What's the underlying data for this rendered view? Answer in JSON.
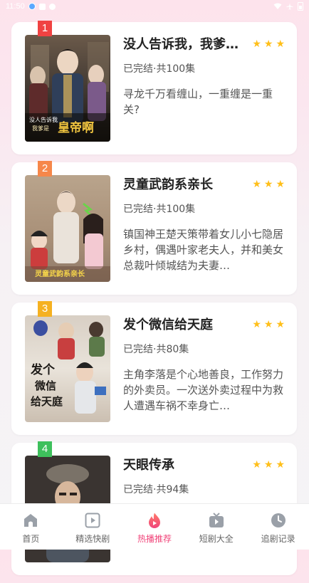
{
  "status_bar": {
    "time": "11:50"
  },
  "colors": {
    "accent": "#f0457a",
    "star": "#ffbf1a",
    "rank_1": "#f04242",
    "rank_2": "#f6874a",
    "rank_3": "#f5b121",
    "rank_4": "#3ec05c"
  },
  "dramas": [
    {
      "rank": "1",
      "title": "没人告诉我，我爹是皇帝啊",
      "status": "已完结·共100集",
      "description": "寻龙千万看缠山，一重缠是一重关?",
      "poster_text": "没人告诉我 我爹是皇帝啊",
      "stars": 3
    },
    {
      "rank": "2",
      "title": "灵童武韵系亲长",
      "status": "已完结·共100集",
      "description": "镇国神王楚天策带着女儿小七隐居乡村，偶遇叶家老夫人，并和美女总裁叶倾城结为夫妻…",
      "poster_text": "灵童武韵系亲长",
      "stars": 3
    },
    {
      "rank": "3",
      "title": "发个微信给天庭",
      "status": "已完结·共80集",
      "description": "主角李落是个心地善良，工作努力的外卖员。一次送外卖过程中为救人遭遇车祸不幸身亡…",
      "poster_text": "发个微信给天庭",
      "stars": 3
    },
    {
      "rank": "4",
      "title": "天眼传承",
      "status": "已完结·共94集",
      "description": "",
      "stars": 3
    }
  ],
  "tabbar": {
    "tabs": [
      {
        "label": "首页",
        "icon": "home-icon"
      },
      {
        "label": "精选快剧",
        "icon": "play-square-icon"
      },
      {
        "label": "热播推荐",
        "icon": "flame-icon",
        "active": true
      },
      {
        "label": "短剧大全",
        "icon": "tv-icon"
      },
      {
        "label": "追剧记录",
        "icon": "clock-icon"
      }
    ]
  }
}
